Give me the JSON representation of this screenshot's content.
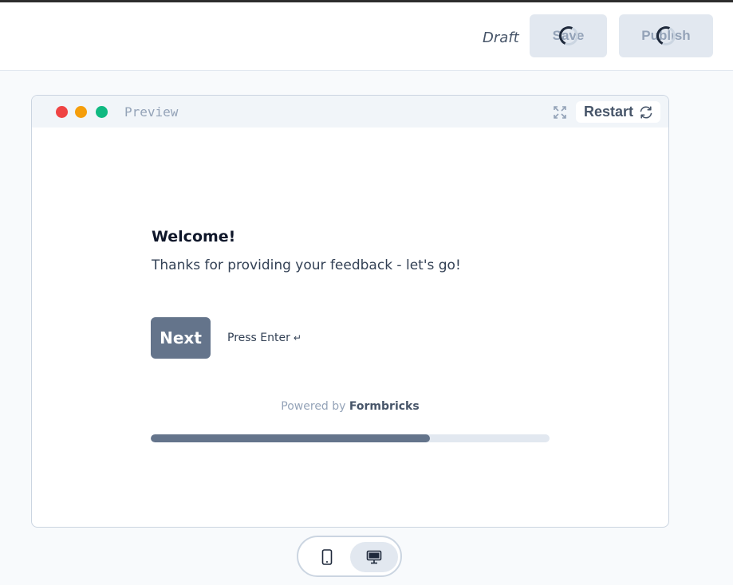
{
  "header": {
    "status": "Draft",
    "save_label": "Save",
    "publish_label": "Publish"
  },
  "preview": {
    "label": "Preview",
    "restart_label": "Restart",
    "window_dots": [
      "#ef4444",
      "#f59e0b",
      "#10b981"
    ]
  },
  "survey": {
    "title": "Welcome!",
    "subtitle": "Thanks for providing your feedback - let's go!",
    "next_label": "Next",
    "press_enter": "Press Enter",
    "enter_glyph": "↵",
    "powered_by": "Powered by",
    "brand": "Formbricks",
    "progress": 0.7
  },
  "device_toggle": {
    "options": [
      "mobile",
      "desktop"
    ],
    "selected": "desktop"
  },
  "colors": {
    "accent": "#64748b",
    "muted": "#e2e8f0"
  }
}
